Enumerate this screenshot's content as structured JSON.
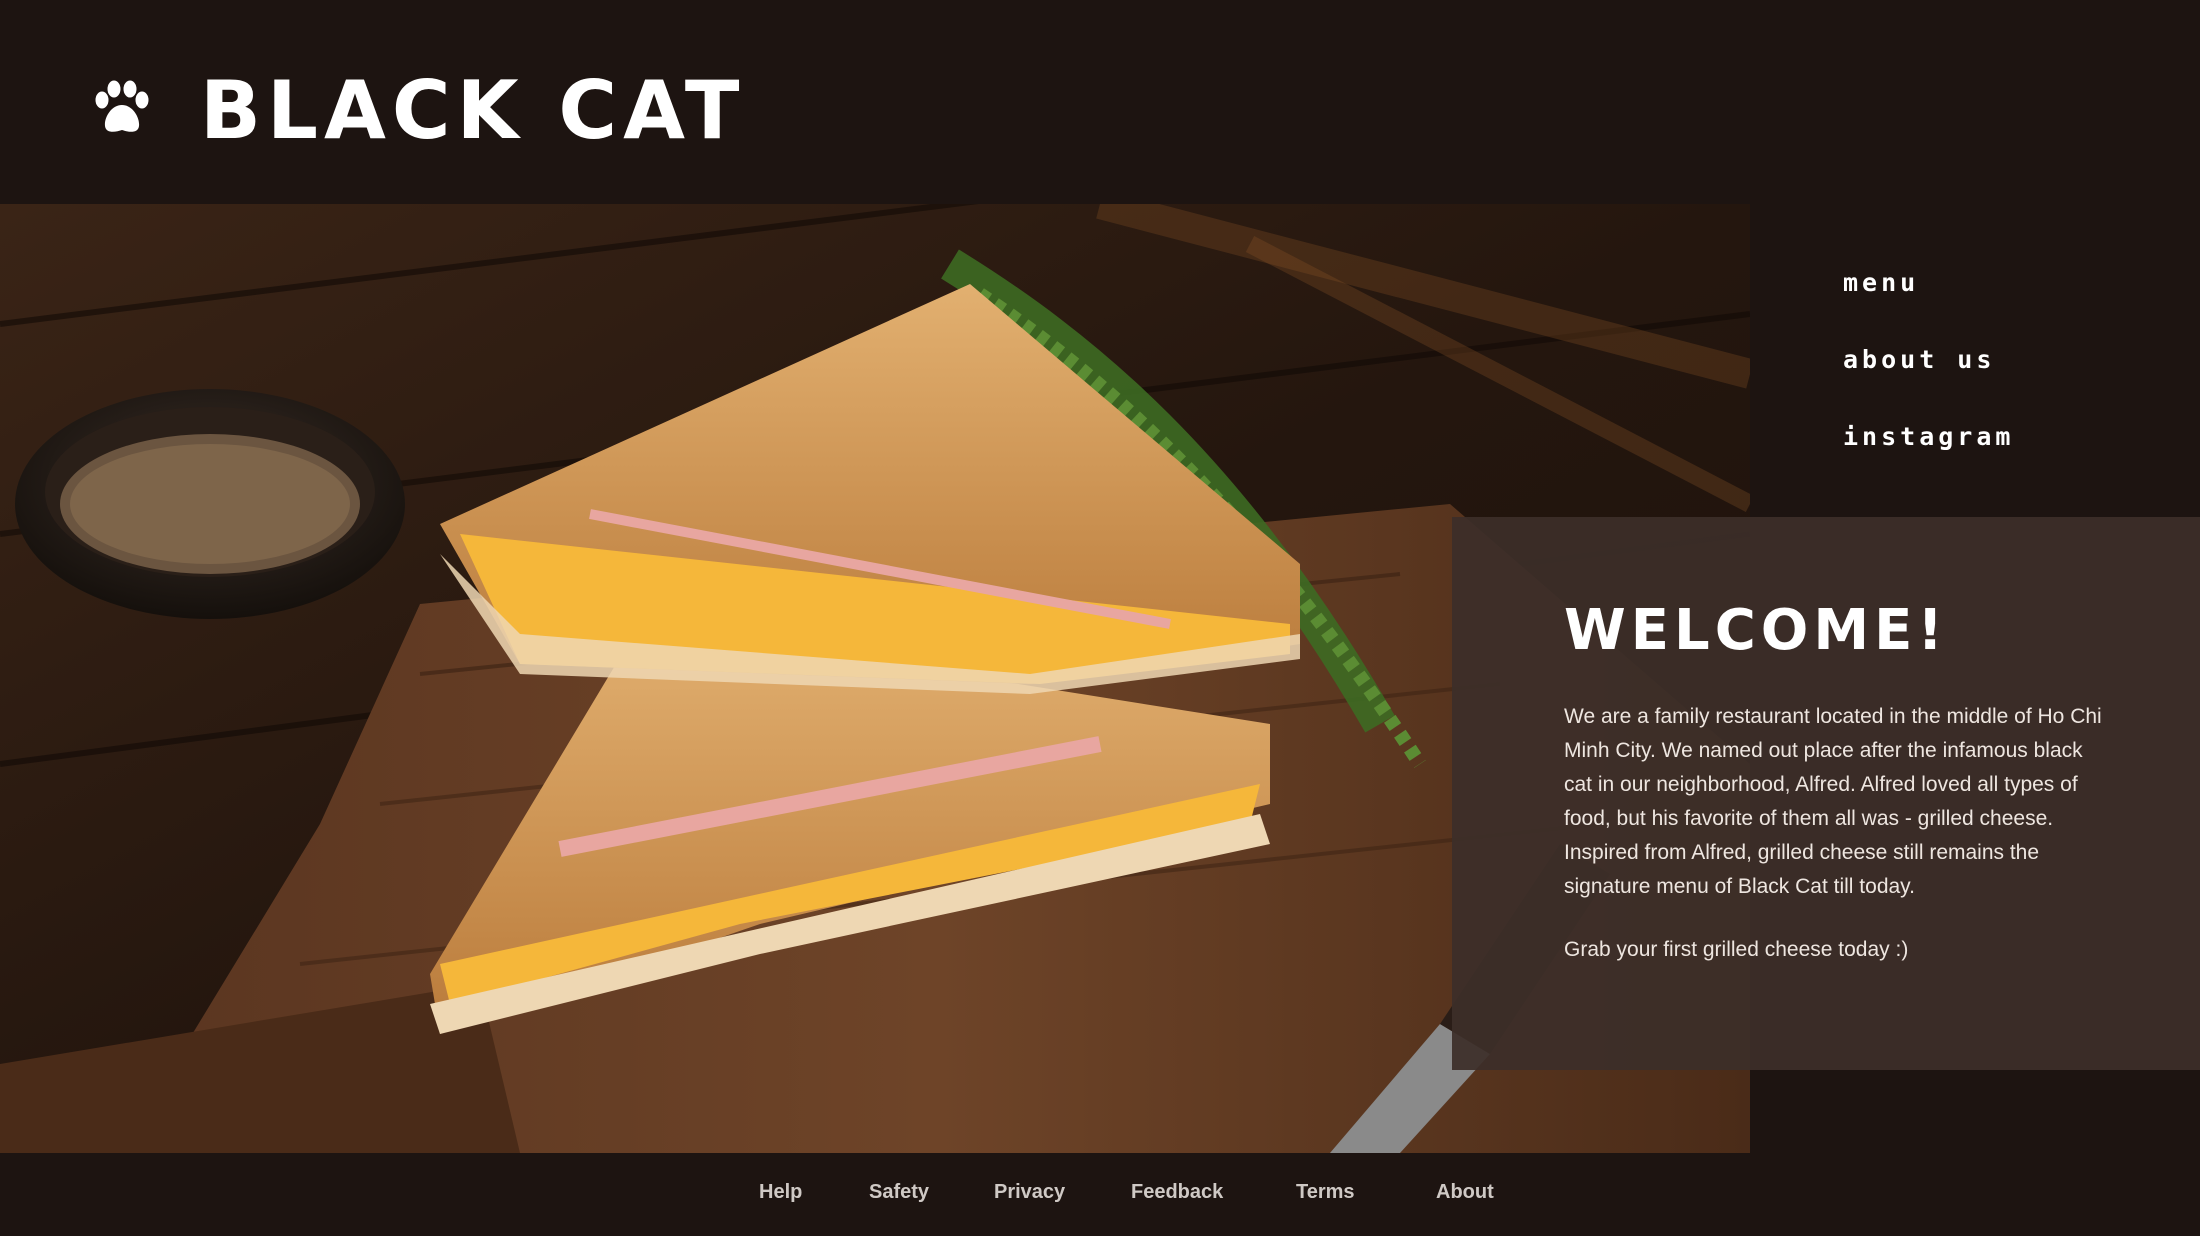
{
  "brand": {
    "name": "BLACK CAT",
    "logo_icon": "paw-icon"
  },
  "nav": {
    "items": [
      "menu",
      "about us",
      "instagram"
    ]
  },
  "welcome": {
    "title": "WELCOME!",
    "body": "We are a family restaurant located in the middle of Ho Chi Minh City. We named out place  after the infamous black cat in our neighborhood, Alfred. Alfred loved all types of food, but his favorite of them all was - grilled cheese. Inspired from Alfred, grilled cheese still remains the signature menu of Black Cat till today.",
    "cta": "Grab your first grilled cheese today :)"
  },
  "footer": {
    "links": [
      "Help",
      "Safety",
      "Privacy",
      "Feedback",
      "Terms",
      "About"
    ]
  },
  "colors": {
    "background": "#1d1411",
    "panel": "#3c2e29",
    "text": "#ffffff",
    "cheese": "#f5b73a"
  }
}
